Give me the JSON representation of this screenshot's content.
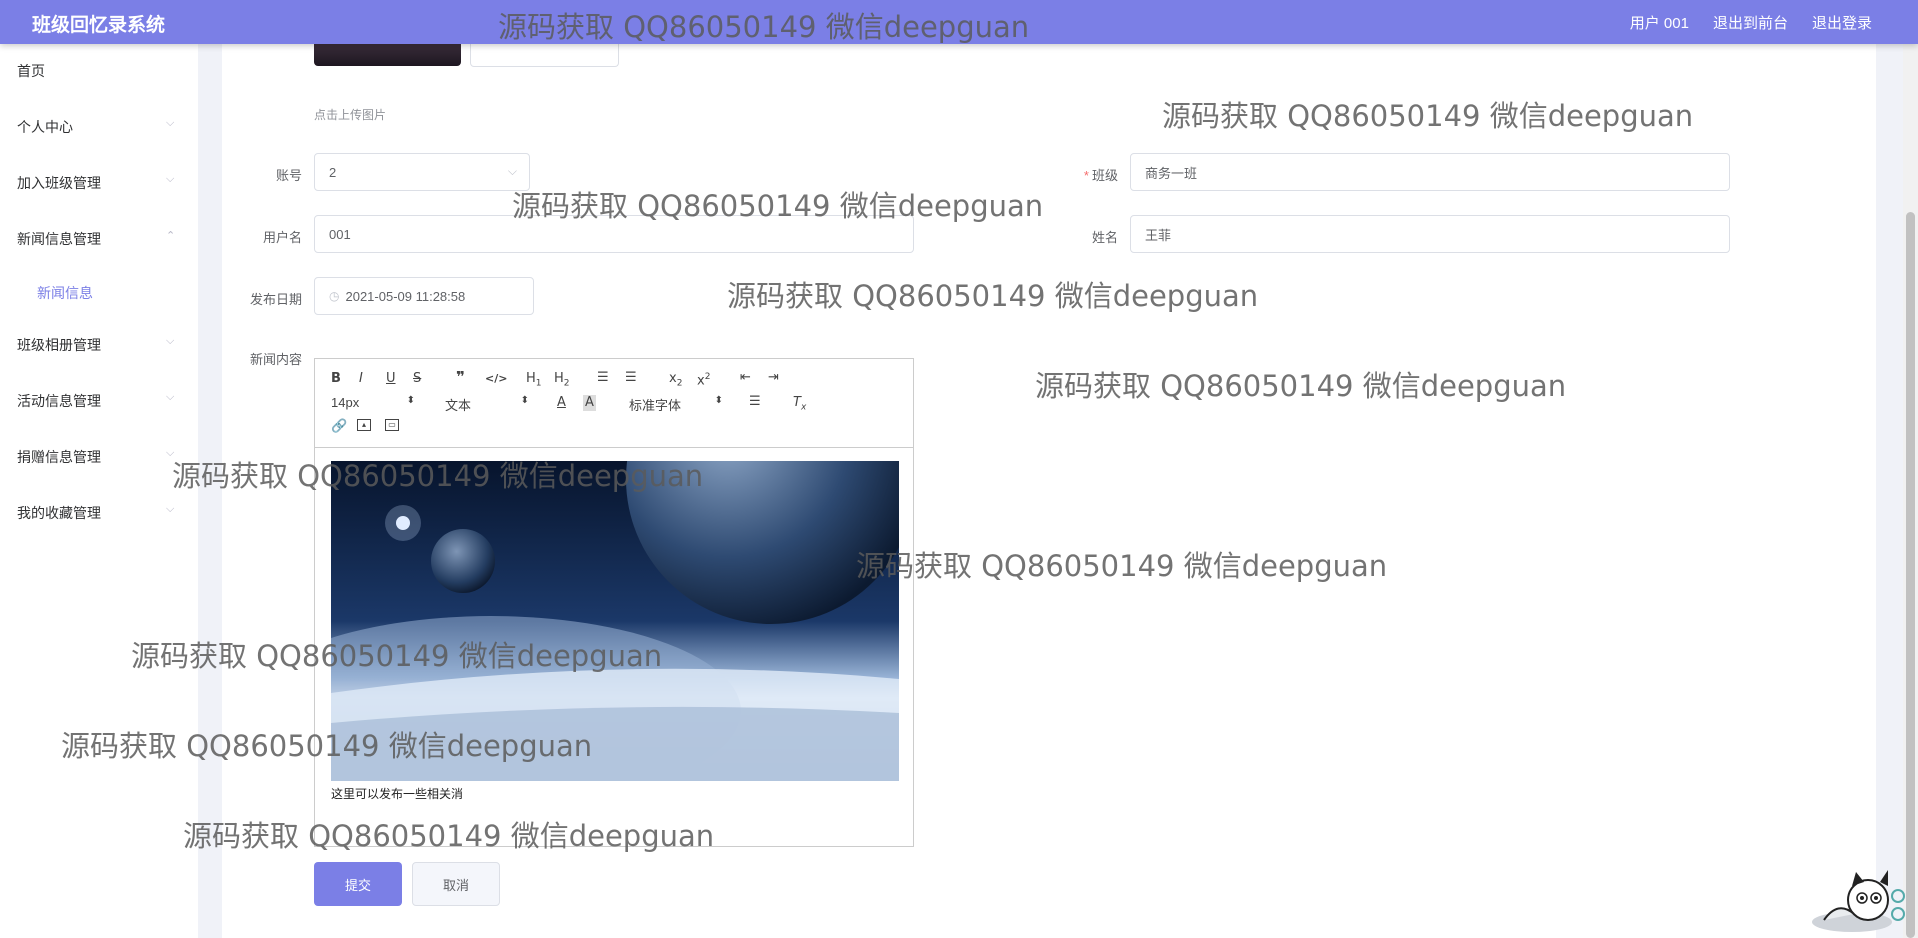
{
  "header": {
    "app_title": "班级回忆录系统",
    "links": [
      "用户 001",
      "退出到前台",
      "退出登录"
    ]
  },
  "sidebar": {
    "items": [
      {
        "label": "首页",
        "arrow": ""
      },
      {
        "label": "个人中心",
        "arrow": "⌵"
      },
      {
        "label": "加入班级管理",
        "arrow": "⌵"
      },
      {
        "label": "新闻信息管理",
        "arrow": "⌃"
      },
      {
        "label": "班级相册管理",
        "arrow": "⌵"
      },
      {
        "label": "活动信息管理",
        "arrow": "⌵"
      },
      {
        "label": "捐赠信息管理",
        "arrow": "⌵"
      },
      {
        "label": "我的收藏管理",
        "arrow": "⌵"
      }
    ],
    "submenu_label": "新闻信息"
  },
  "form": {
    "upload_hint": "点击上传图片",
    "account_label": "账号",
    "account_value": "2",
    "class_label": "班级",
    "class_value": "商务一班",
    "username_label": "用户名",
    "username_value": "001",
    "name_label": "姓名",
    "name_value": "王菲",
    "date_label": "发布日期",
    "date_value": "2021-05-09 11:28:58",
    "content_label": "新闻内容"
  },
  "editor": {
    "font_size": "14px",
    "format": "文本",
    "font_family": "标准字体",
    "body_text": "这里可以发布一些相关消"
  },
  "buttons": {
    "submit": "提交",
    "cancel": "取消"
  },
  "watermark": "源码获取 QQ86050149 微信deepguan"
}
